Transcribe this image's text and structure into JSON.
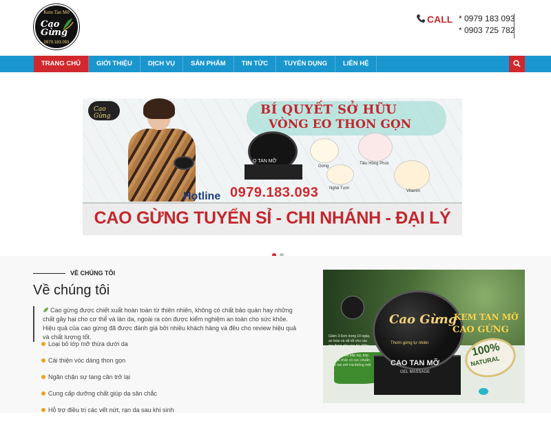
{
  "header": {
    "logo": {
      "top_text": "Kem Tan Mỡ",
      "brand": "Cao Gừng",
      "bottom_text": "0979.183.093"
    },
    "call_label": "CALL",
    "phones": [
      "* 0979 183 093",
      "* 0903 725 782"
    ]
  },
  "nav": {
    "items": [
      {
        "label": "TRANG CHỦ",
        "active": true
      },
      {
        "label": "GIỚI THIỆU"
      },
      {
        "label": "DỊCH VỤ"
      },
      {
        "label": "SẢN PHẨM"
      },
      {
        "label": "TIN TỨC"
      },
      {
        "label": "TUYỂN DỤNG"
      },
      {
        "label": "LIÊN HỆ"
      }
    ],
    "search_icon": "search-icon",
    "colors": {
      "bar": "#1a96cf",
      "active": "#d0282c"
    }
  },
  "banner": {
    "logo_text": "Cao Gừng",
    "title_line1": "BÍ QUYẾT SỞ HỮU",
    "title_line2": "VÒNG EO THON GỌN",
    "jar_text": "O TAN MỠ",
    "ingredients": [
      "Gừng",
      "Tiêu Hồng Phúc",
      "Nghệ Tươi",
      "Vitamin"
    ],
    "hotline_label": "Hotline",
    "hotline_number": "0979.183.093",
    "bottom_text": "CAO GỪNG TUYỂN SỈ - CHI NHÁNH - ĐẠI LÝ",
    "slides": 2,
    "active_slide": 0
  },
  "about": {
    "kicker": "VỀ CHÚNG TÔI",
    "title": "Về chúng tôi",
    "description": "Cao gừng được chiết xuất hoàn toàn từ thiên nhiên, không có chất bảo quản hay những chất gây hại cho cơ thể và làn da, ngoài ra còn được kiểm nghiệm an toàn cho sức khỏe. Hiệu quả của cao gừng đã được đánh giá bởi nhiều khách hàng và đều cho review hiệu quả và chất lượng tốt.",
    "bullets": [
      "Loại bỏ lớp mỡ thừa dưới da",
      "Cải thiện vóc dáng thon gọn",
      "Ngăn chặn sự tang cân trở lại",
      "Cung cấp dưỡng chất giúp da săn chắc",
      "Hỗ trợ điều trị các vết nứt, rạn da sau khi sinh"
    ],
    "product_image": {
      "brand": "Cao Gừng",
      "sub": "Thơm gừng tự nhiên",
      "name": "CAO TAN MỠ",
      "gel": "GEL MASSAGE",
      "kem": "KEM TAN MỠ",
      "cao": "CAO GỪNG",
      "badge_top": "100%",
      "badge_bottom": "NATURAL",
      "side_text": "Giảm 3-5cm trong 10 ngày, an toàn và rất tốt cho các mẹ đang cho con bú. Hiệu quả tan mỡ vượt trội. Thơm gừng bắp đùi bắp tay, bóp eo, săn chắc có cực chuẩn, đánh tan mỡ mà không mệt mỏi."
    }
  }
}
